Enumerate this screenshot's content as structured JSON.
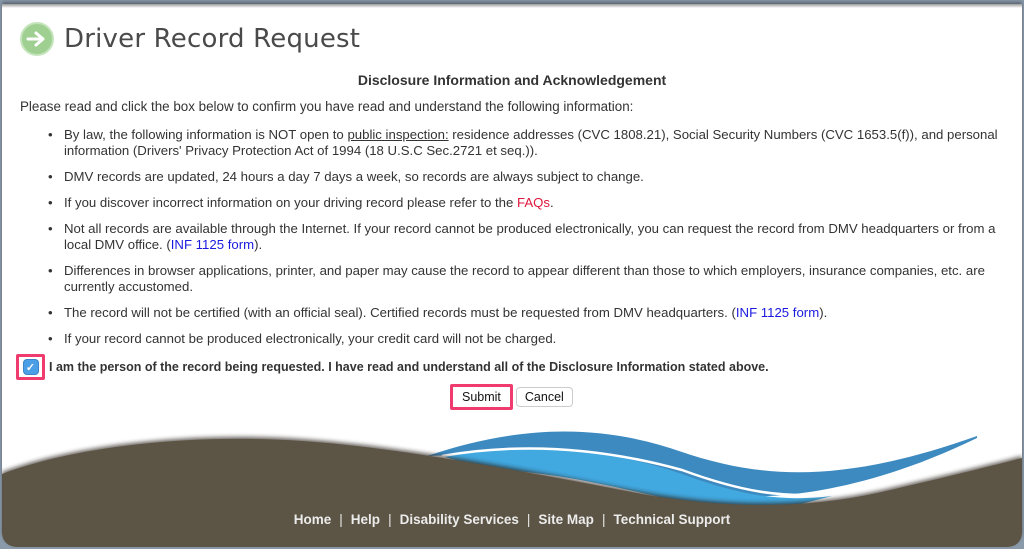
{
  "header": {
    "title": "Driver Record Request",
    "icon": "arrow-right-circle-icon"
  },
  "section_title": "Disclosure Information and Acknowledgement",
  "intro": "Please read and click the box below to confirm you have read and understand the following information:",
  "items": [
    {
      "pre": "By law, the following information is NOT open to ",
      "link": "public inspection:",
      "post": " residence addresses (CVC 1808.21), Social Security Numbers (CVC 1653.5(f)), and personal information (Drivers' Privacy Protection Act of 1994 (18 U.S.C Sec.2721 et seq.))."
    },
    {
      "text": "DMV records are updated, 24 hours a day 7 days a week, so records are always subject to change."
    },
    {
      "pre": "If you discover incorrect information on your driving record please refer to the ",
      "link": "FAQs",
      "post": "."
    },
    {
      "pre": "Not all records are available through the Internet. If your record cannot be produced electronically, you can request the record from DMV headquarters or from a local DMV office. (",
      "link": "INF 1125 form",
      "post": ")."
    },
    {
      "text": "Differences in browser applications, printer, and paper may cause the record to appear different than those to which employers, insurance companies, etc. are currently accustomed."
    },
    {
      "pre": "The record will not be certified (with an official seal). Certified records must be requested from DMV headquarters. (",
      "link": "INF 1125 form",
      "post": ")."
    },
    {
      "text": "If your record cannot be produced electronically, your credit card will not be charged."
    }
  ],
  "acknowledgement": {
    "checked": true,
    "label": "I am the person of the record being requested. I have read and understand all of the Disclosure Information stated above."
  },
  "buttons": {
    "submit": "Submit",
    "cancel": "Cancel"
  },
  "footer": {
    "links": [
      "Home",
      "Help",
      "Disability Services",
      "Site Map",
      "Technical Support"
    ],
    "separator": "|"
  },
  "colors": {
    "highlight": "#ef3b6e",
    "faq_link": "#e0163c",
    "form_link": "#1a1adf",
    "footer_bg": "#5c5444",
    "wave_blue": "#3d8ac0",
    "wave_light_blue": "#41a8e0"
  }
}
